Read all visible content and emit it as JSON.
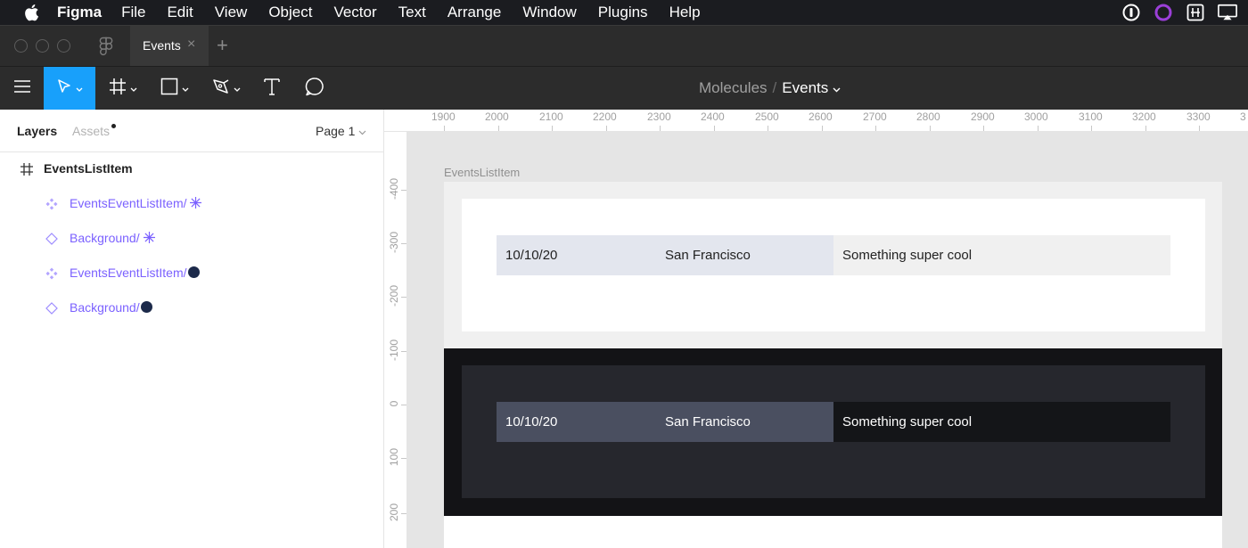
{
  "menubar": {
    "app_name": "Figma",
    "items": [
      "File",
      "Edit",
      "View",
      "Object",
      "Vector",
      "Text",
      "Arrange",
      "Window",
      "Plugins",
      "Help"
    ],
    "tray_icons": [
      "onepassword-icon",
      "creative-cloud-icon",
      "keyboard-icon",
      "airplay-icon"
    ]
  },
  "tabbar": {
    "tab_label": "Events",
    "close_glyph": "×",
    "add_glyph": "+"
  },
  "toolbar": {
    "tools": [
      "menu-icon",
      "move-tool-icon",
      "frame-tool-icon",
      "shape-tool-icon",
      "pen-tool-icon",
      "text-tool-icon",
      "comment-tool-icon"
    ],
    "accent": "#18a0fb"
  },
  "breadcrumb": {
    "project": "Molecules",
    "separator": "/",
    "file": "Events"
  },
  "panel": {
    "tabs": {
      "layers": "Layers",
      "assets": "Assets"
    },
    "page": "Page 1",
    "layers": [
      {
        "label": "EventsListItem",
        "type": "frame"
      },
      {
        "label": "EventsEventListItem/",
        "type": "component",
        "theme": "light"
      },
      {
        "label": "Background/",
        "type": "instance",
        "theme": "light"
      },
      {
        "label": "EventsEventListItem/",
        "type": "component",
        "theme": "dark"
      },
      {
        "label": "Background/",
        "type": "instance",
        "theme": "dark"
      }
    ],
    "layer_color": "#7b61ff"
  },
  "rulers": {
    "top": [
      "1900",
      "2000",
      "2100",
      "2200",
      "2300",
      "2400",
      "2500",
      "2600",
      "2700",
      "2800",
      "2900",
      "3000",
      "3100",
      "3200",
      "3300",
      "3"
    ],
    "left": [
      "-400",
      "-300",
      "-200",
      "-100",
      "0",
      "100",
      "200"
    ]
  },
  "canvas": {
    "frame_label": "EventsListItem",
    "light_row": {
      "date": "10/10/20",
      "location": "San Francisco",
      "title": "Something super cool"
    },
    "dark_row": {
      "date": "10/10/20",
      "location": "San Francisco",
      "title": "Something super cool"
    }
  }
}
